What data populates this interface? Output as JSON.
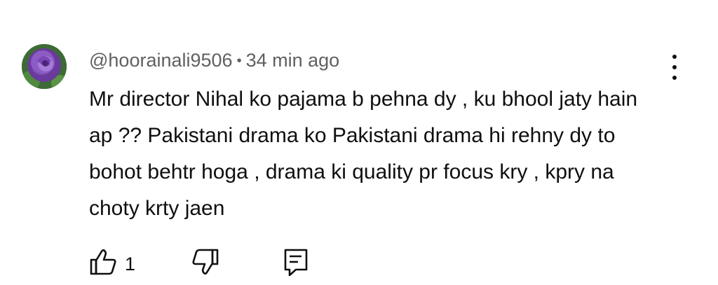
{
  "comment": {
    "author": "@hoorainali9506",
    "separator": "•",
    "time": "34 min ago",
    "text": "Mr director Nihal ko pajama b pehna dy , ku bhool jaty hain ap ?? Pakistani drama ko Pakistani drama hi rehny dy to bohot behtr hoga , drama ki quality pr focus kry , kpry na choty krty jaen",
    "like_count": "1"
  },
  "icons": {
    "avatar": "purple-rose-avatar",
    "more": "more-vert-icon",
    "like": "thumbs-up-icon",
    "dislike": "thumbs-down-icon",
    "reply": "comment-reply-icon"
  },
  "colors": {
    "meta": "#606060",
    "text": "#0f0f0f",
    "background": "#ffffff"
  }
}
